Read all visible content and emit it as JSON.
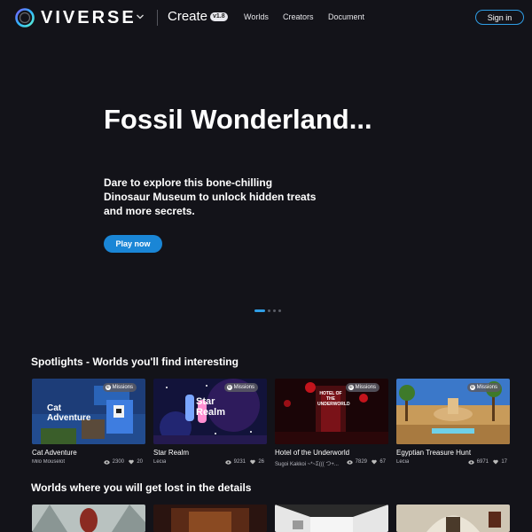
{
  "header": {
    "brand": "VIVERSE",
    "create_label": "Create",
    "version": "v1.8",
    "nav": [
      "Worlds",
      "Creators",
      "Document"
    ],
    "signin": "Sign in"
  },
  "hero": {
    "title": "Fossil Wonderland...",
    "description": "Dare to explore this bone-chilling Dinosaur Museum to unlock hidden treats and more secrets.",
    "cta": "Play now",
    "carousel": {
      "slides": 4,
      "active": 0
    }
  },
  "spotlights": {
    "title": "Spotlights - Worlds you'll find interesting",
    "cards": [
      {
        "title": "Cat Adventure",
        "author": "Milo Mouselot",
        "views": "2300",
        "likes": "20",
        "badge": "Missions",
        "thumb_text": "Cat Adventure"
      },
      {
        "title": "Star Realm",
        "author": "Lecia",
        "views": "9231",
        "likes": "26",
        "badge": "Missions",
        "thumb_text": "Star Realm"
      },
      {
        "title": "Hotel of the Underworld",
        "author": "Sugoi Kakkoi ~*~Σ((( つ+...",
        "views": "7829",
        "likes": "67",
        "badge": "Missions",
        "thumb_text": "HOTEL OF THE UNDERWORLD"
      },
      {
        "title": "Egyptian Treasure Hunt",
        "author": "Lecia",
        "views": "6971",
        "likes": "17",
        "badge": "Missions",
        "thumb_text": ""
      }
    ]
  },
  "details_section": {
    "title": "Worlds where you will get lost in the details"
  },
  "colors": {
    "background": "#131319",
    "accent": "#1a86d6",
    "signin_border": "#2f9ee6"
  },
  "icons": [
    "viverse-logo-icon",
    "chevron-down-icon",
    "eye-icon",
    "heart-icon",
    "mission-icon"
  ]
}
